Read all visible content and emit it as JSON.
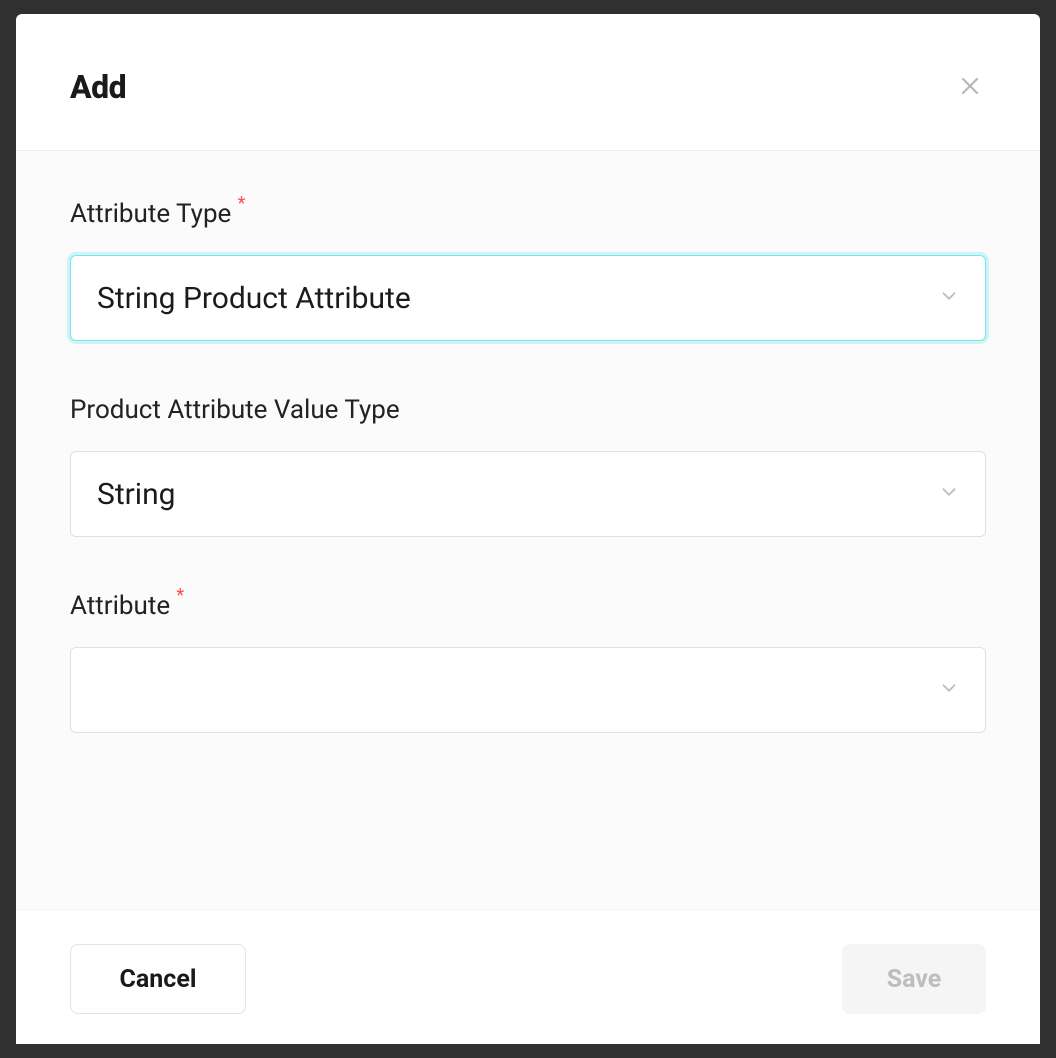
{
  "modal": {
    "title": "Add",
    "fields": {
      "attribute_type": {
        "label": "Attribute Type",
        "required": true,
        "value": "String Product Attribute",
        "focused": true
      },
      "value_type": {
        "label": "Product Attribute Value Type",
        "required": false,
        "value": "String",
        "focused": false
      },
      "attribute": {
        "label": "Attribute",
        "required": true,
        "value": "",
        "focused": false
      }
    },
    "footer": {
      "cancel_label": "Cancel",
      "save_label": "Save",
      "save_disabled": true
    }
  }
}
